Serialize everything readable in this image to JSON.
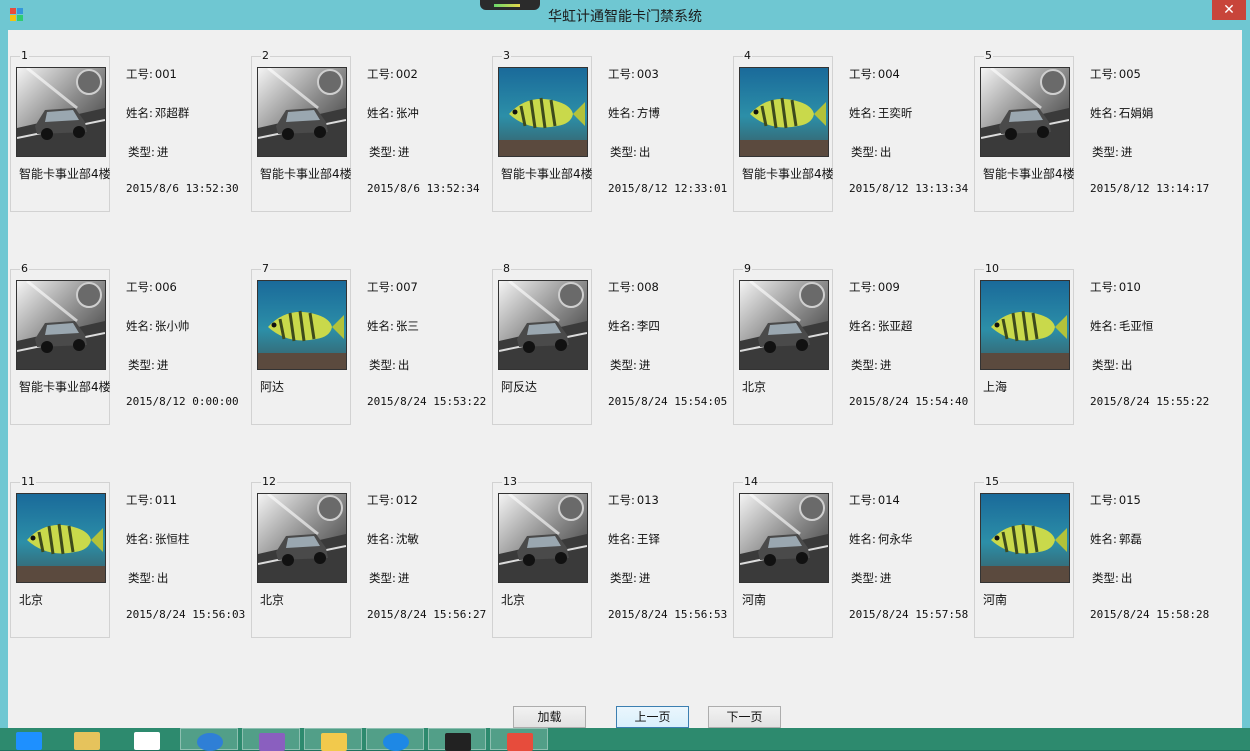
{
  "window": {
    "title": "华虹计通智能卡门禁系统",
    "close_label": "✕"
  },
  "labels": {
    "id": "工号:",
    "name": "姓名:",
    "type": "类型:"
  },
  "records": [
    {
      "index": "1",
      "id": "001",
      "name": "邓超群",
      "type": "进",
      "location": "智能卡事业部4楼",
      "time": "2015/8/6 13:52:30",
      "photo": "car-photo"
    },
    {
      "index": "2",
      "id": "002",
      "name": "张冲",
      "type": "进",
      "location": "智能卡事业部4楼",
      "time": "2015/8/6 13:52:34",
      "photo": "car-photo"
    },
    {
      "index": "3",
      "id": "003",
      "name": "方博",
      "type": "出",
      "location": "智能卡事业部4楼",
      "time": "2015/8/12 12:33:01",
      "photo": "fish-photo"
    },
    {
      "index": "4",
      "id": "004",
      "name": "王奕昕",
      "type": "出",
      "location": "智能卡事业部4楼",
      "time": "2015/8/12 13:13:34",
      "photo": "fish-photo"
    },
    {
      "index": "5",
      "id": "005",
      "name": "石娟娟",
      "type": "进",
      "location": "智能卡事业部4楼",
      "time": "2015/8/12 13:14:17",
      "photo": "car-photo"
    },
    {
      "index": "6",
      "id": "006",
      "name": "张小帅",
      "type": "进",
      "location": "智能卡事业部4楼",
      "time": "2015/8/12 0:00:00",
      "photo": "car-photo"
    },
    {
      "index": "7",
      "id": "007",
      "name": "张三",
      "type": "出",
      "location": "阿达",
      "time": "2015/8/24 15:53:22",
      "photo": "fish-photo"
    },
    {
      "index": "8",
      "id": "008",
      "name": "李四",
      "type": "进",
      "location": "阿反达",
      "time": "2015/8/24 15:54:05",
      "photo": "car-photo"
    },
    {
      "index": "9",
      "id": "009",
      "name": "张亚超",
      "type": "进",
      "location": "北京",
      "time": "2015/8/24 15:54:40",
      "photo": "car-photo"
    },
    {
      "index": "10",
      "id": "010",
      "name": "毛亚恒",
      "type": "出",
      "location": "上海",
      "time": "2015/8/24 15:55:22",
      "photo": "fish-photo"
    },
    {
      "index": "11",
      "id": "011",
      "name": "张恒柱",
      "type": "出",
      "location": "北京",
      "time": "2015/8/24 15:56:03",
      "photo": "fish-photo"
    },
    {
      "index": "12",
      "id": "012",
      "name": "沈敏",
      "type": "进",
      "location": "北京",
      "time": "2015/8/24 15:56:27",
      "photo": "car-photo"
    },
    {
      "index": "13",
      "id": "013",
      "name": "王铎",
      "type": "进",
      "location": "北京",
      "time": "2015/8/24 15:56:53",
      "photo": "car-photo"
    },
    {
      "index": "14",
      "id": "014",
      "name": "何永华",
      "type": "进",
      "location": "河南",
      "time": "2015/8/24 15:57:58",
      "photo": "car-photo"
    },
    {
      "index": "15",
      "id": "015",
      "name": "郭磊",
      "type": "出",
      "location": "河南",
      "time": "2015/8/24 15:58:28",
      "photo": "fish-photo"
    }
  ],
  "buttons": {
    "load": "加载",
    "prev": "上一页",
    "next": "下一页"
  },
  "taskbar": {
    "icons": [
      "ie-icon",
      "folder-icon",
      "window-icon",
      "sogou-icon",
      "visual-studio-icon",
      "app-icon",
      "qq-browser-icon",
      "photo-app-icon",
      "office-icon"
    ]
  },
  "colors": {
    "titlebar": "#6fc7d2",
    "close": "#c8453a",
    "client": "#f0f0f0",
    "taskbar": "#2d8a6e"
  }
}
